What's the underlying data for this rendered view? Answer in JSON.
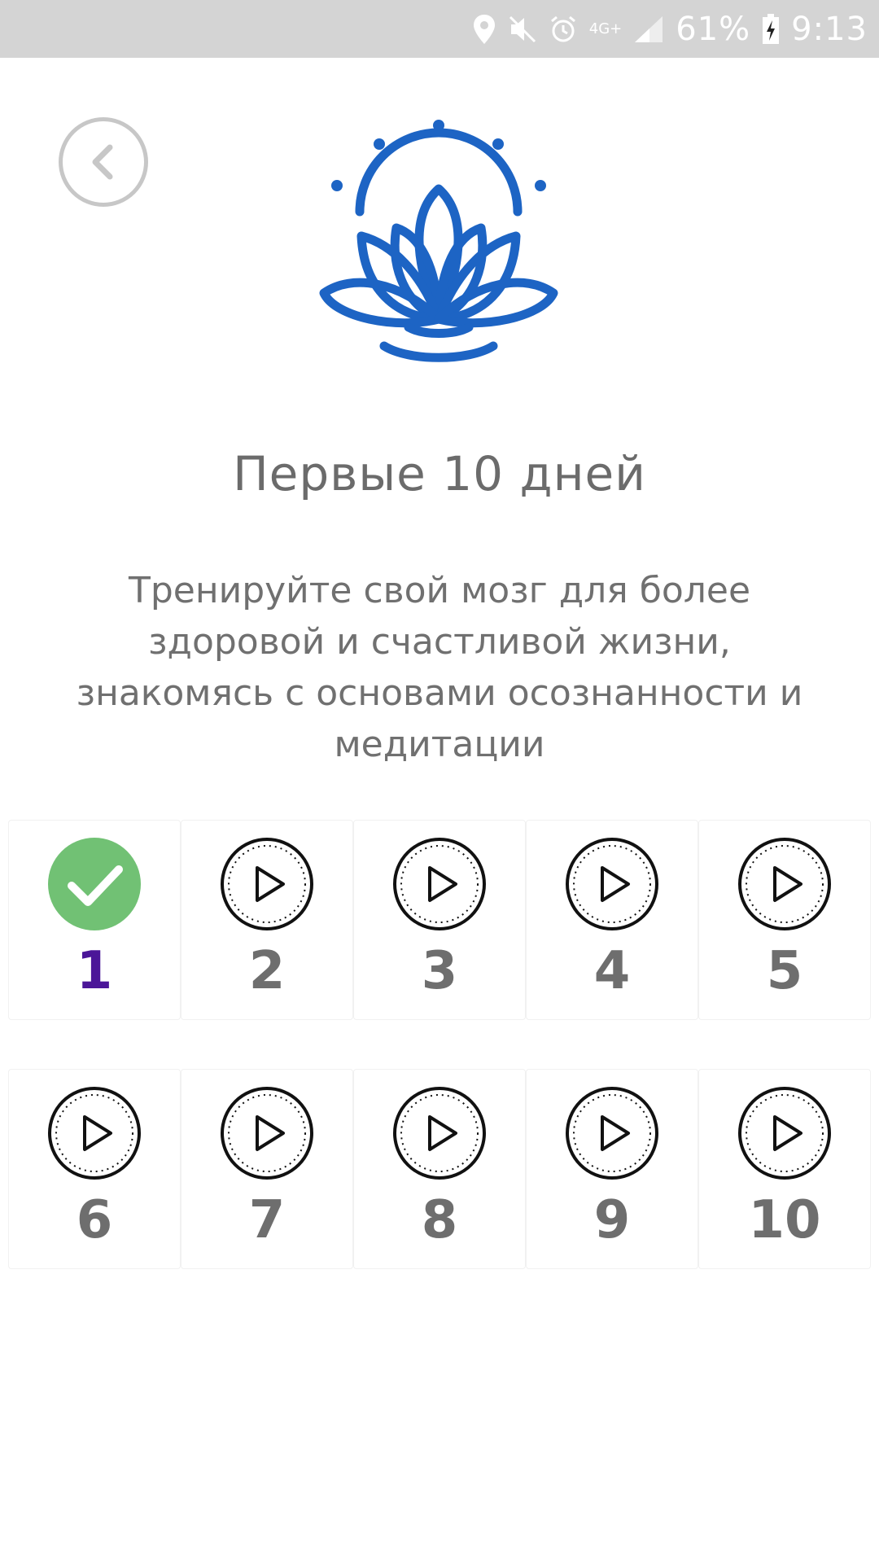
{
  "status_bar": {
    "network": "4G+",
    "battery": "61%",
    "time": "9:13",
    "icons": [
      "location-icon",
      "mute-icon",
      "alarm-icon",
      "network-icon",
      "signal-icon",
      "battery-charging-icon"
    ]
  },
  "header": {
    "back_icon": "chevron-left-icon",
    "logo_icon": "lotus-sun-icon"
  },
  "course": {
    "title": "Первые 10 дней",
    "description": "Тренируйте свой мозг для более здоровой и счастливой жизни, знакомясь с основами осознанности и медитации"
  },
  "days": [
    {
      "number": "1",
      "status": "completed",
      "icon": "check-circle-icon"
    },
    {
      "number": "2",
      "status": "available",
      "icon": "play-icon"
    },
    {
      "number": "3",
      "status": "available",
      "icon": "play-icon"
    },
    {
      "number": "4",
      "status": "available",
      "icon": "play-icon"
    },
    {
      "number": "5",
      "status": "available",
      "icon": "play-icon"
    },
    {
      "number": "6",
      "status": "available",
      "icon": "play-icon"
    },
    {
      "number": "7",
      "status": "available",
      "icon": "play-icon"
    },
    {
      "number": "8",
      "status": "available",
      "icon": "play-icon"
    },
    {
      "number": "9",
      "status": "available",
      "icon": "play-icon"
    },
    {
      "number": "10",
      "status": "available",
      "icon": "play-icon"
    }
  ],
  "colors": {
    "status_bar_bg": "#d4d4d4",
    "logo_blue": "#1d64c4",
    "completed_green": "#71c174",
    "completed_number": "#4b1698",
    "text_gray": "#6e6e6e"
  }
}
